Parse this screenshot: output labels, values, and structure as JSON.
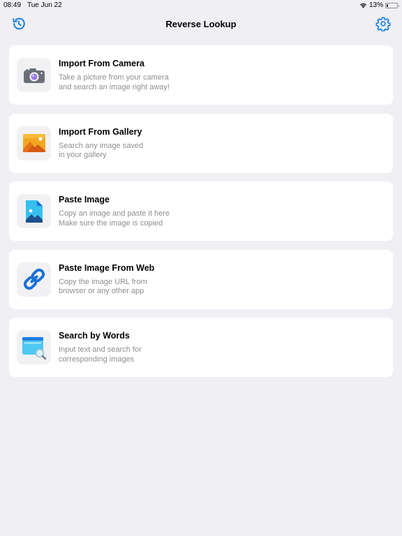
{
  "status_bar": {
    "time": "08:49",
    "date": "Tue Jun 22",
    "battery": "13%"
  },
  "nav": {
    "title": "Reverse Lookup",
    "left_icon": "history-icon",
    "right_icon": "gear-icon"
  },
  "colors": {
    "accent": "#1a7ee0",
    "background": "#efeff4",
    "card": "#ffffff",
    "subtitle": "#8e8e93"
  },
  "items": [
    {
      "title": "Import From Camera",
      "line1": "Take a picture from your camera",
      "line2": "and search an image right away!",
      "icon": "camera-icon"
    },
    {
      "title": "Import From Gallery",
      "line1": "Search any image saved",
      "line2": "in your gallery",
      "icon": "gallery-icon"
    },
    {
      "title": "Paste Image",
      "line1": "Copy an image and paste it here",
      "line2": "Make sure the image is copied",
      "icon": "paste-image-icon"
    },
    {
      "title": "Paste Image From Web",
      "line1": "Copy the image URL from",
      "line2": "browser or any other app",
      "icon": "link-icon"
    },
    {
      "title": "Search by Words",
      "line1": "Input text and search for",
      "line2": "corresponding images",
      "icon": "browser-search-icon"
    }
  ]
}
